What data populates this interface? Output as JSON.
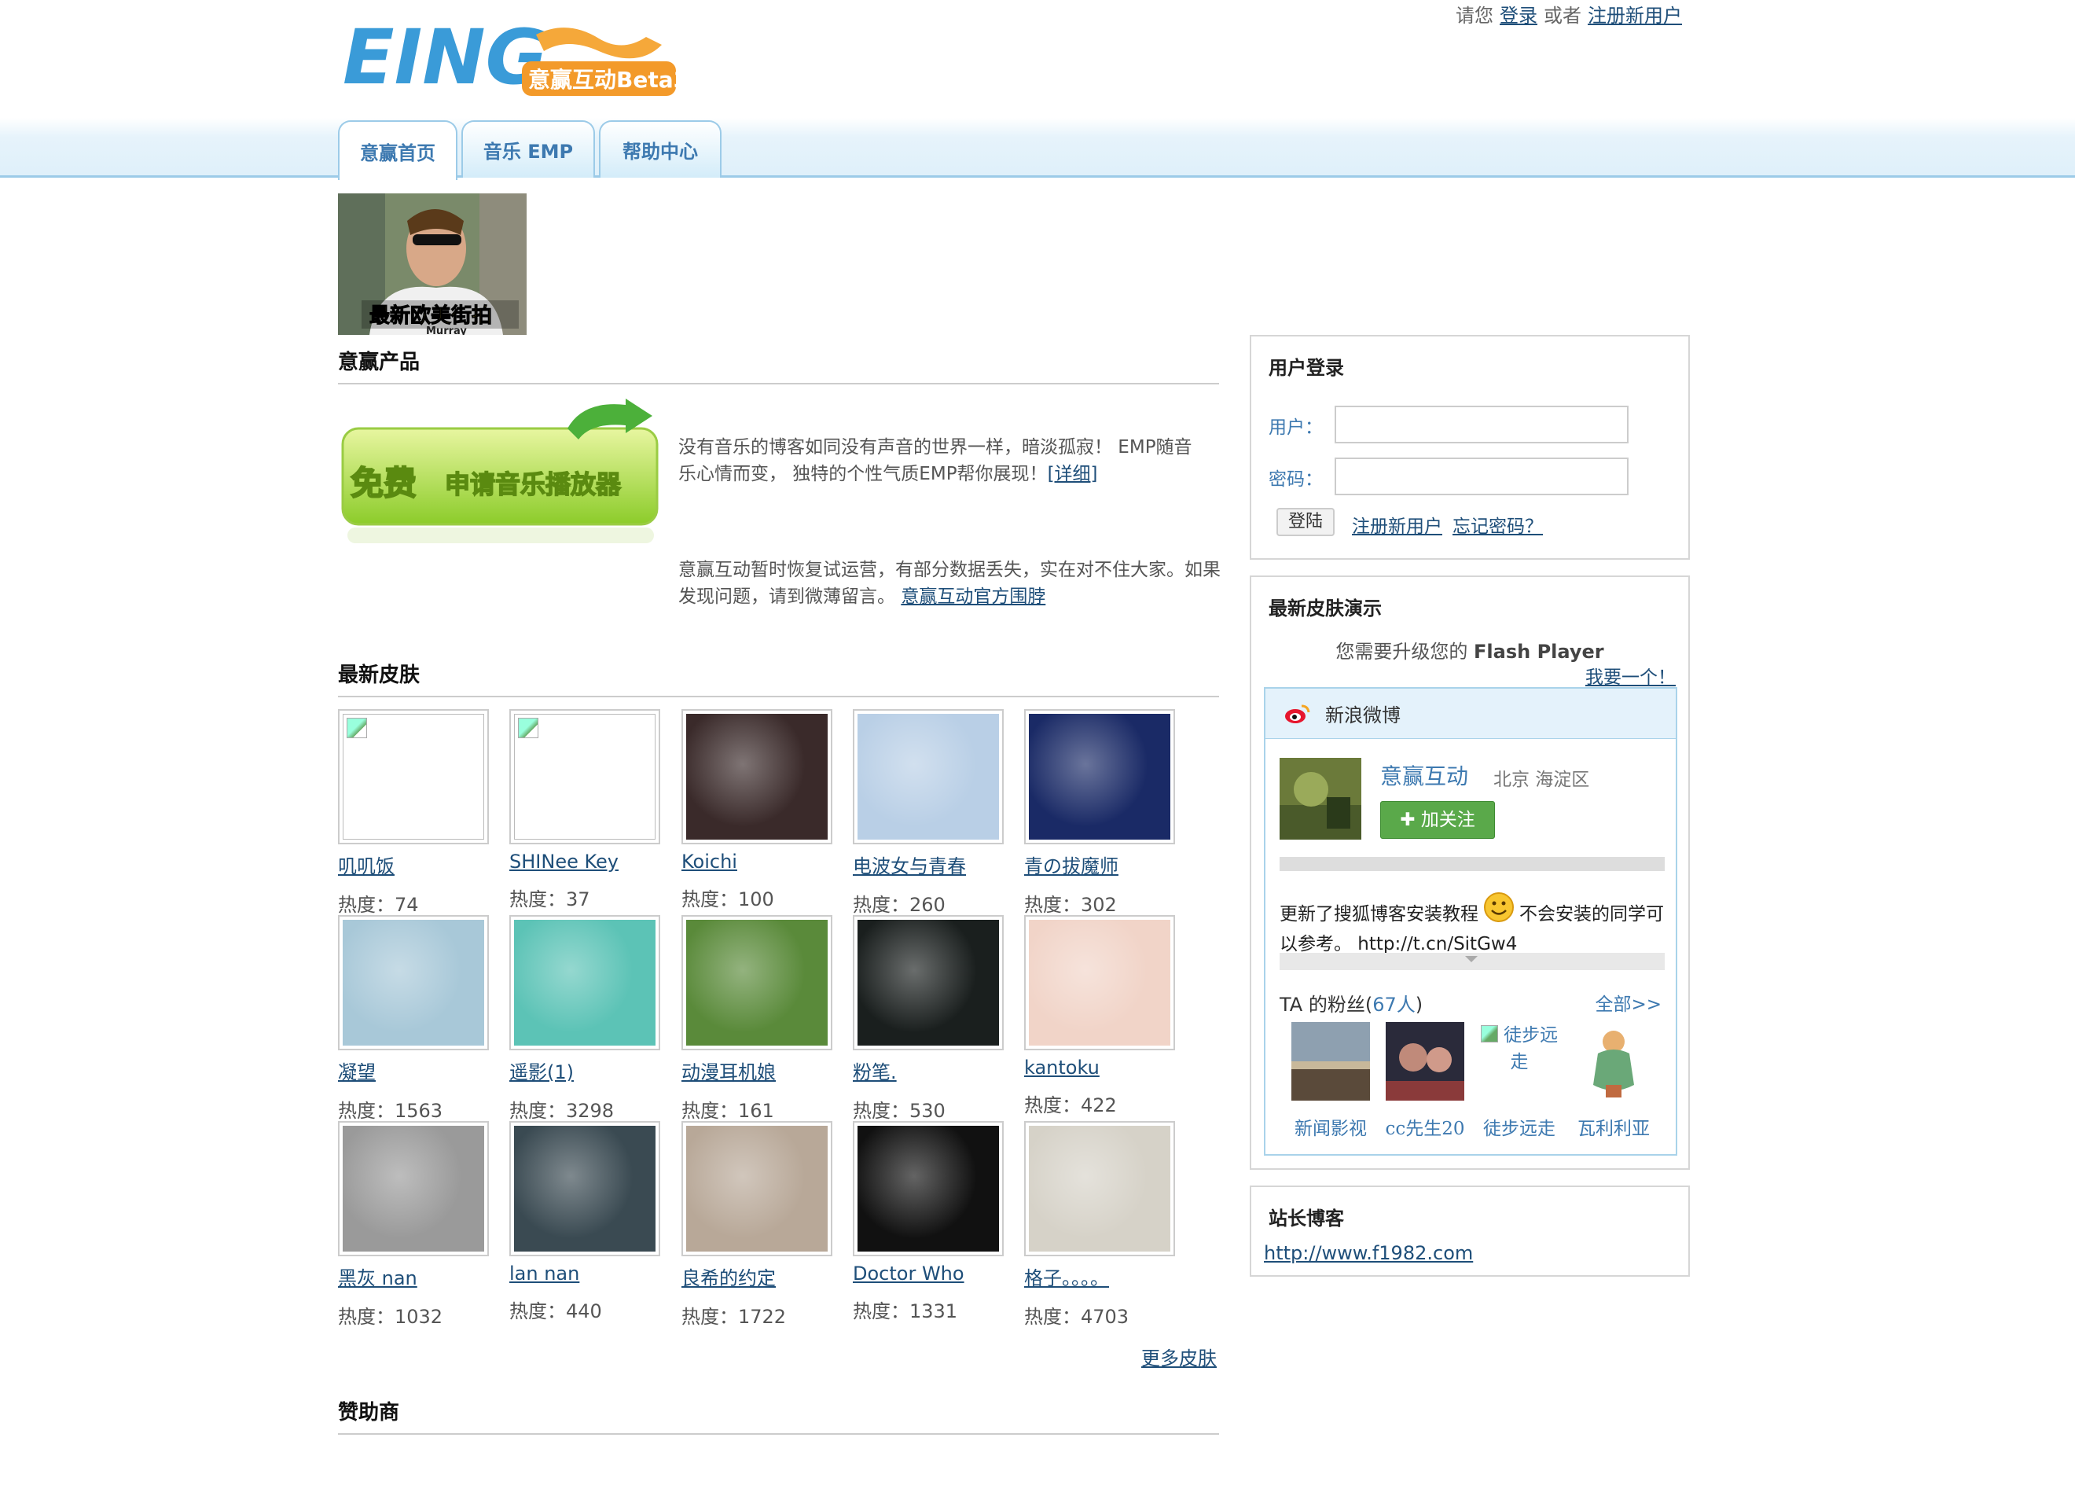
{
  "header": {
    "logo_text": "EING",
    "logo_sub": "意赢互动Beta3",
    "please": "请您",
    "login": "登录",
    "or": "或者",
    "register": "注册新用户"
  },
  "tabs": [
    {
      "label": "意赢首页",
      "active": true
    },
    {
      "label": "音乐 EMP",
      "active": false
    },
    {
      "label": "帮助中心",
      "active": false
    }
  ],
  "banner": {
    "caption": "最新欧美街拍",
    "tag": "Murray"
  },
  "products": {
    "title": "意赢产品",
    "player_badge": "免费",
    "player_label": "申请音乐播放器",
    "desc": "没有音乐的博客如同没有声音的世界一样，暗淡孤寂！ EMP随音乐心情而变， 独特的个性气质EMP帮你展现！",
    "detail_link": "[详细]",
    "notice": "意赢互动暂时恢复试运营，有部分数据丢失，实在对不住大家。如果发现问题，请到微薄留言。",
    "notice_link": "意赢互动官方围脖"
  },
  "skins": {
    "title": "最新皮肤",
    "heat_prefix": "热度：",
    "items": [
      {
        "name": "叽叽饭",
        "heat": "74",
        "color": "broken"
      },
      {
        "name": "SHINee Key",
        "heat": "37",
        "color": "broken"
      },
      {
        "name": "Koichi",
        "heat": "100",
        "color": "#3a2a2a"
      },
      {
        "name": "电波女与青春",
        "heat": "260",
        "color": "#b9cfe6"
      },
      {
        "name": "青の拔魔师",
        "heat": "302",
        "color": "#1a2a66"
      },
      {
        "name": "凝望",
        "heat": "1563",
        "color": "#a8c8d8"
      },
      {
        "name": "遥影(1)",
        "heat": "3298",
        "color": "#5cc3b6"
      },
      {
        "name": "动漫耳机娘",
        "heat": "161",
        "color": "#5a8a3a"
      },
      {
        "name": "粉笔.",
        "heat": "530",
        "color": "#1a1f1e"
      },
      {
        "name": "kantoku",
        "heat": "422",
        "color": "#f1d4c8"
      },
      {
        "name": "黑灰 nan",
        "heat": "1032",
        "color": "#9a9a9a"
      },
      {
        "name": "lan nan",
        "heat": "440",
        "color": "#3a4a52"
      },
      {
        "name": "良希的约定",
        "heat": "1722",
        "color": "#b8a898"
      },
      {
        "name": "Doctor Who",
        "heat": "1331",
        "color": "#111111"
      },
      {
        "name": "格子。。。。",
        "heat": "4703",
        "color": "#d6d2c8"
      }
    ],
    "more": "更多皮肤"
  },
  "sponsors": {
    "title": "赞助商"
  },
  "login_box": {
    "title": "用户登录",
    "user_label": "用户：",
    "pass_label": "密码：",
    "user_value": "",
    "pass_value": "",
    "submit": "登陆",
    "register": "注册新用户",
    "forgot": "忘记密码？"
  },
  "skin_demo": {
    "title": "最新皮肤演示",
    "flash_prefix": "您需要升级您的",
    "flash_name": "Flash Player",
    "get_one": "我要一个！"
  },
  "weibo": {
    "header": "新浪微博",
    "name": "意赢互动",
    "location": "北京 海淀区",
    "follow": "✚ 加关注",
    "post_part1": "更新了搜狐博客安装教程",
    "post_part2": "不会安装的同学可以参考。 http://t.cn/SitGw4",
    "fans_prefix": "TA 的粉丝(",
    "fans_count": "67人",
    "fans_suffix": ")",
    "fans_all": "全部>>",
    "fans": [
      {
        "name": "新闻影视",
        "alt": ""
      },
      {
        "name": "cc先生20",
        "alt": ""
      },
      {
        "name": "徒步远走",
        "alt": "徒步远走"
      },
      {
        "name": "瓦利利亚",
        "alt": ""
      }
    ]
  },
  "blog_box": {
    "title": "站长博客",
    "link": "http://www.f1982.com"
  }
}
